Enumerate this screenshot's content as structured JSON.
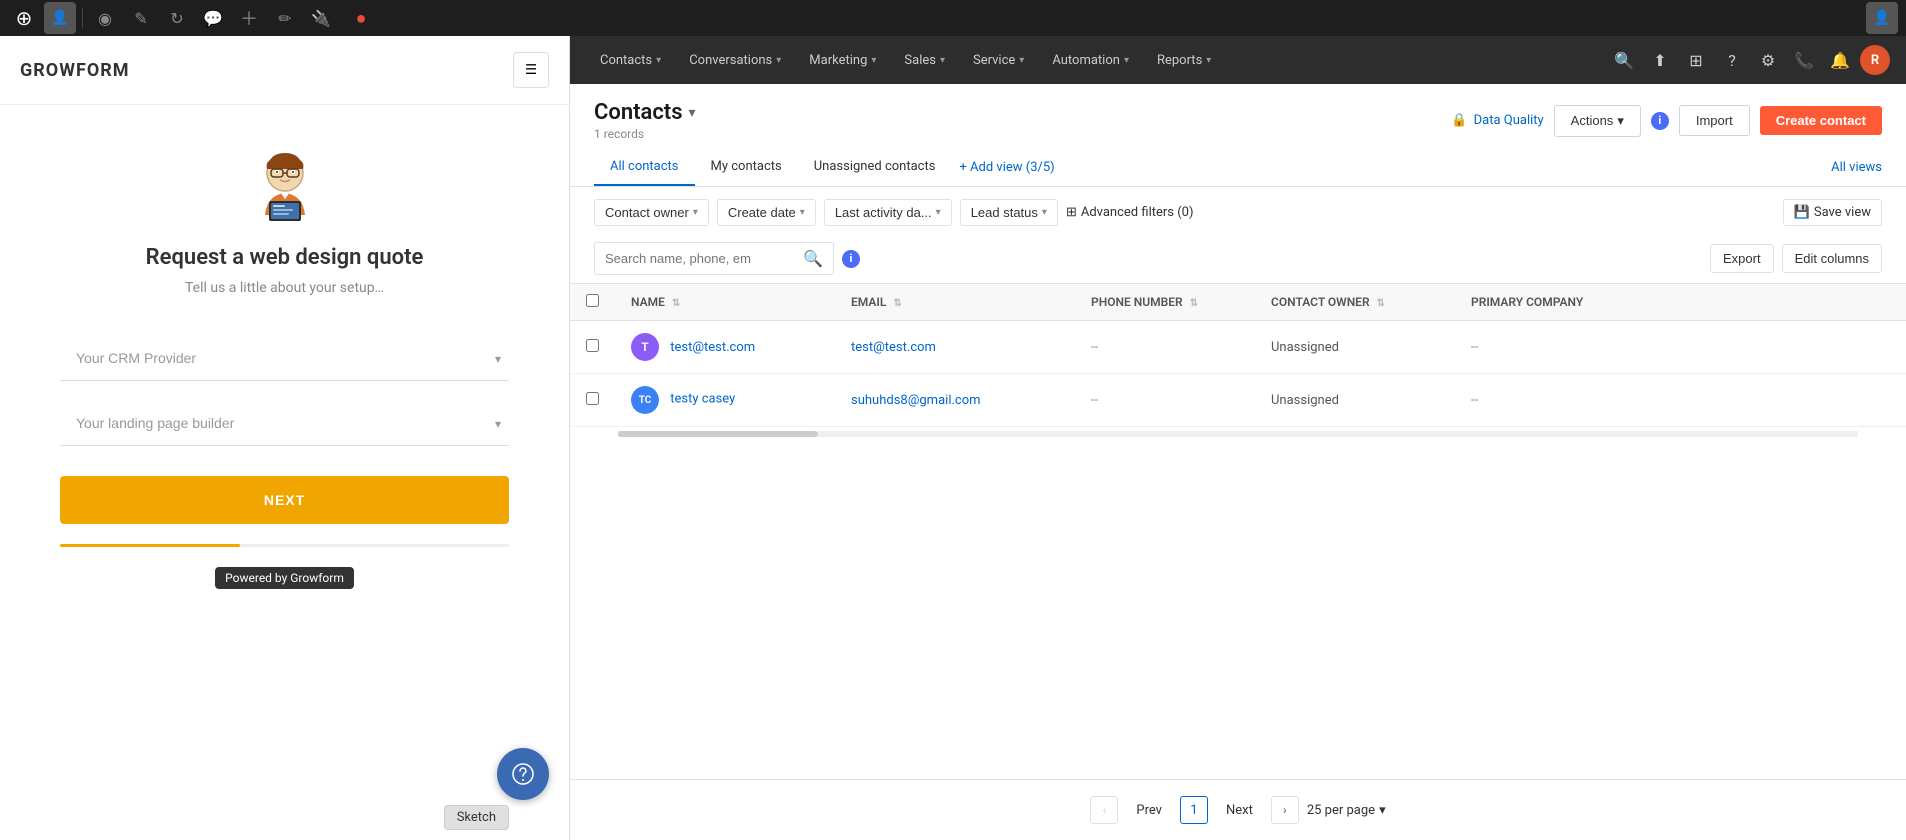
{
  "wp_toolbar": {
    "icons": [
      {
        "name": "wordpress-icon",
        "symbol": "⊕"
      },
      {
        "name": "dashboard-icon",
        "symbol": "◎"
      },
      {
        "name": "edit-icon",
        "symbol": "✎"
      },
      {
        "name": "refresh-icon",
        "symbol": "↻"
      },
      {
        "name": "comment-icon",
        "symbol": "💬"
      },
      {
        "name": "add-icon",
        "symbol": "+"
      },
      {
        "name": "paint-icon",
        "symbol": "✏"
      },
      {
        "name": "plugin-icon",
        "symbol": "🔌"
      },
      {
        "name": "record-icon",
        "symbol": "●",
        "color": "#e74c3c"
      }
    ]
  },
  "growform": {
    "logo": "GROWFORM",
    "form_title": "Request a web design quote",
    "form_subtitle": "Tell us a little about your setup…",
    "crm_placeholder": "Your CRM Provider",
    "landing_placeholder": "Your landing page builder",
    "next_button": "NEXT",
    "powered_text": "Powered by Growform"
  },
  "hubspot": {
    "nav": {
      "items": [
        {
          "label": "Contacts",
          "has_arrow": true
        },
        {
          "label": "Conversations",
          "has_arrow": true
        },
        {
          "label": "Marketing",
          "has_arrow": true
        },
        {
          "label": "Sales",
          "has_arrow": true
        },
        {
          "label": "Service",
          "has_arrow": true
        },
        {
          "label": "Automation",
          "has_arrow": true
        },
        {
          "label": "Reports",
          "has_arrow": true
        }
      ]
    },
    "page": {
      "title": "Contacts",
      "records_count": "1 records",
      "data_quality_label": "Data Quality",
      "actions_label": "Actions",
      "import_label": "Import",
      "create_contact_label": "Create contact"
    },
    "tabs": {
      "all_contacts": "All contacts",
      "my_contacts": "My contacts",
      "unassigned_contacts": "Unassigned contacts",
      "add_view": "+ Add view (3/5)",
      "all_views": "All views"
    },
    "filters": {
      "contact_owner": "Contact owner",
      "create_date": "Create date",
      "last_activity": "Last activity da...",
      "lead_status": "Lead status",
      "advanced": "Advanced filters (0)",
      "save_view": "Save view"
    },
    "search": {
      "placeholder": "Search name, phone, em",
      "export_label": "Export",
      "edit_columns_label": "Edit columns"
    },
    "table": {
      "columns": [
        {
          "label": "NAME"
        },
        {
          "label": "EMAIL"
        },
        {
          "label": "PHONE NUMBER"
        },
        {
          "label": "CONTACT OWNER"
        },
        {
          "label": "PRIMARY COMPANY"
        }
      ],
      "rows": [
        {
          "avatar_text": "T",
          "avatar_color": "#8b5cf6",
          "name": "test@test.com",
          "name_is_email": true,
          "email": "test@test.com",
          "phone": "--",
          "owner": "Unassigned",
          "company": "--"
        },
        {
          "avatar_text": "TC",
          "avatar_color": "#3b82f6",
          "name": "testy casey",
          "name_is_email": false,
          "email": "suhuhds8@gmail.com",
          "phone": "--",
          "owner": "Unassigned",
          "company": "--"
        }
      ]
    },
    "pagination": {
      "prev_label": "Prev",
      "current_page": "1",
      "next_label": "Next",
      "per_page_label": "25 per page"
    }
  }
}
